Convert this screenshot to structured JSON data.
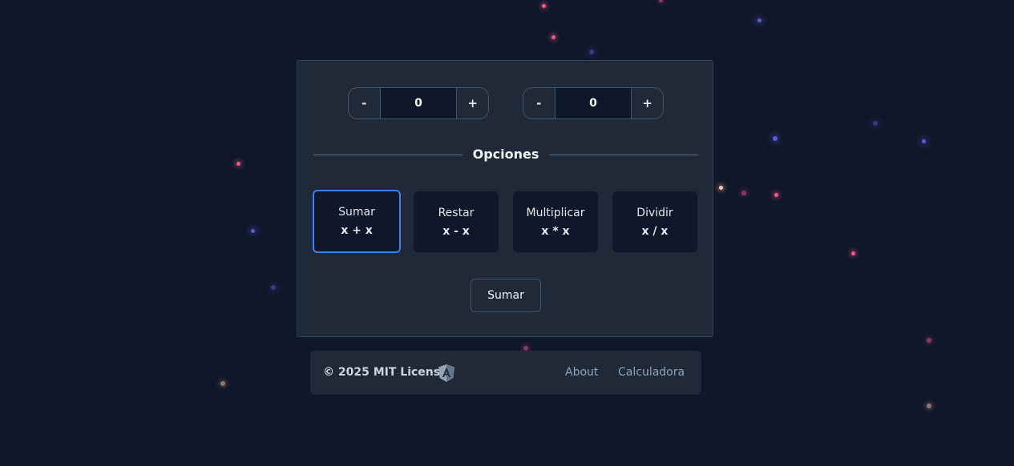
{
  "steppers": [
    {
      "minus_label": "-",
      "value": "0",
      "plus_label": "+"
    },
    {
      "minus_label": "-",
      "value": "0",
      "plus_label": "+"
    }
  ],
  "options_heading": "Opciones",
  "operations": [
    {
      "name": "Sumar",
      "formula": "x + x",
      "selected": true
    },
    {
      "name": "Restar",
      "formula": "x - x",
      "selected": false
    },
    {
      "name": "Multiplicar",
      "formula": "x * x",
      "selected": false
    },
    {
      "name": "Dividir",
      "formula": "x / x",
      "selected": false
    }
  ],
  "submit_label": "Sumar",
  "footer": {
    "copyright": "© 2025 MIT License",
    "logo_icon": "angular-logo-icon",
    "links": [
      "About",
      "Calculadora"
    ]
  },
  "colors": {
    "background": "#0f172a",
    "card": "#1f2937",
    "accent": "#3b82f6",
    "particle_pink": "#f0588a",
    "particle_blue": "#5b5bd6"
  }
}
